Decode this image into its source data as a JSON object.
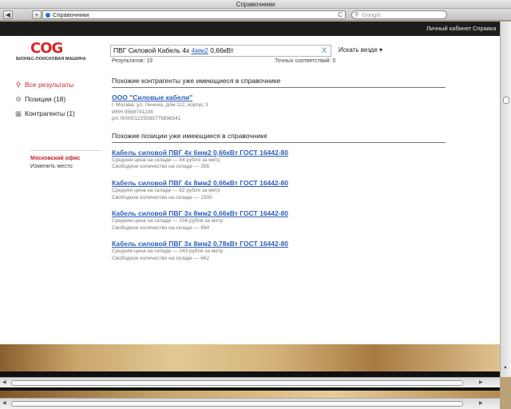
{
  "window": {
    "title": "Справочники"
  },
  "toolbar": {
    "back": "◀",
    "add_tab": "+",
    "url": "Справочники",
    "reload": "C",
    "search_placeholder": "Google"
  },
  "topbar": {
    "cabinet": "Личный кабинет",
    "help": "Справка"
  },
  "logo": {
    "mark_left": "СО",
    "mark_right": "G",
    "sub": "БИЗНЕС-ПОИСКОВАЯ МАШИНА"
  },
  "search": {
    "query_prefix": "ПВГ Силовой Кабель 4х",
    "query_highlight": "4мм2",
    "query_suffix": "0,66кВт",
    "clear": "X",
    "scope": "Искать везде",
    "results": "Результатов: 19",
    "exact": "Точных соответствий: 0"
  },
  "sidebar": {
    "items": [
      {
        "icon": "search-icon",
        "label": "Все результаты"
      },
      {
        "icon": "gear-icon",
        "label": "Позиции (18)"
      },
      {
        "icon": "building-icon",
        "label": "Контрагенты (1)"
      }
    ],
    "office": "Московский офис",
    "change": "Изменить место"
  },
  "contractors": {
    "heading": "Похожие контрагенты уже имеющиеся в справочнике",
    "items": [
      {
        "title": "ООО \"Силовые кабели\"",
        "lines": [
          "г. Москва, ул. Ленина, дом 112, корпус 3",
          "ИНН 9568741236",
          "р/с 00000122558577989654​1"
        ]
      }
    ]
  },
  "positions": {
    "heading": "Похожие позиции уже имеющиеся в справочнике",
    "items": [
      {
        "title": "Кабель силовой ПВГ 4х 6мм2 0,66кВт ГОСТ 16442-80",
        "price": "Средняя цена на складе — 84 рубля за метр",
        "qty": "Свободное количество на складе — 356"
      },
      {
        "title": "Кабель силовой ПВГ 4х 8мм2 0,66кВт ГОСТ 16442-80",
        "price": "Средняя цена на складе — 62 рубля за метр",
        "qty": "Свободное количество на складе — 1500"
      },
      {
        "title": "Кабель силовой ПВГ 3х 8мм2 0,66кВт ГОСТ 16442-80",
        "price": "Средняя цена на складе — 156 рубля за метр",
        "qty": "Свободное количество на складе — 894"
      },
      {
        "title": "Кабель силовой ПВГ 3х 8мм2 0,78кВт ГОСТ 16442-80",
        "price": "Средняя цена на складе — 243 рубля за метр",
        "qty": "Свободное количество на складе — 662"
      }
    ]
  }
}
